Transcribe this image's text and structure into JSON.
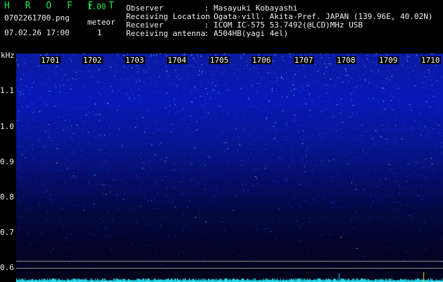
{
  "header": {
    "title": "H R O F F T",
    "version": "1.00",
    "filename": "0702261700.png",
    "meteor_label": "meteor",
    "datetime": "07.02.26 17:00",
    "meteor_count": "1"
  },
  "info": [
    {
      "label": "Observer",
      "value": ": Masayuki Kobayashi"
    },
    {
      "label": "Receiving Location",
      "value": ": Ogata-vill. Akita-Pref. JAPAN (139.96E, 40.02N)"
    },
    {
      "label": "Receiver",
      "value": ": ICOM IC-575 53.7492(@LCD)MHz USB"
    },
    {
      "label": "Receiving antenna",
      "value": ": A504HB(yagi 4el)"
    }
  ],
  "axis": {
    "unit": "kHz",
    "y_ticks": [
      "1.1",
      "1.0",
      "0.9",
      "0.8",
      "0.7",
      "0.6"
    ],
    "x_ticks": [
      "1701",
      "1702",
      "1703",
      "1704",
      "1705",
      "1706",
      "1707",
      "1708",
      "1709",
      "1710"
    ]
  },
  "colors": {
    "title_green": "#22e84a",
    "spectrum_blue": "#0818b8",
    "signal_cyan": "#28d8e8"
  }
}
